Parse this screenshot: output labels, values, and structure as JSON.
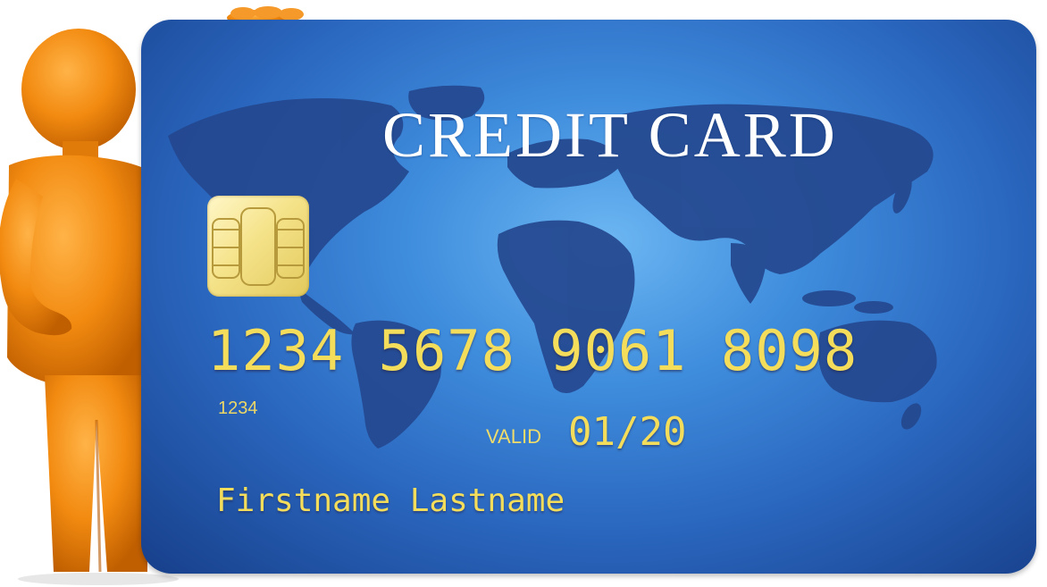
{
  "card": {
    "title": "CREDIT CARD",
    "number": "1234 5678 9061 8098",
    "small_code": "1234",
    "valid_label": "VALID",
    "valid_date": "01/20",
    "holder_name": "Firstname Lastname"
  },
  "colors": {
    "card_blue": "#2f74cf",
    "map_navy": "#24488f",
    "number_yellow": "#f3dd5a",
    "chip_gold": "#f5e38a",
    "figure_orange": "#f28a10"
  },
  "icons": [
    "world-map",
    "emv-chip",
    "orange-figure"
  ]
}
